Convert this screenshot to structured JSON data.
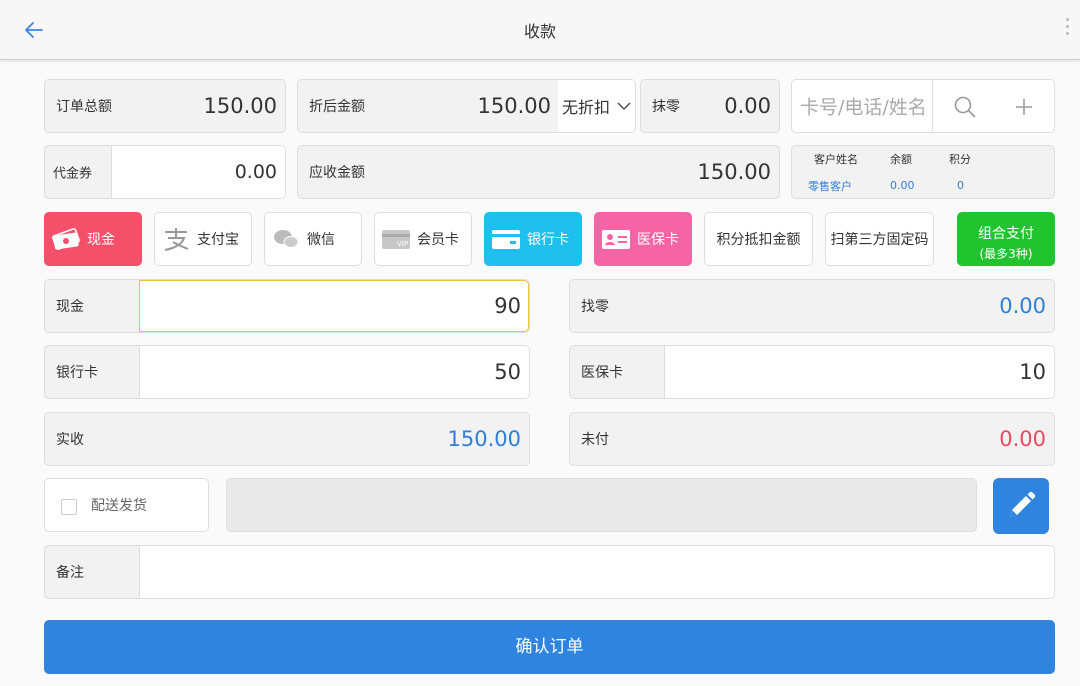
{
  "header": {
    "title": "收款"
  },
  "summary": {
    "order_total_label": "订单总额",
    "order_total_value": "150.00",
    "discounted_label": "折后金额",
    "discounted_value": "150.00",
    "discount_option": "无折扣",
    "rounding_label": "抹零",
    "rounding_value": "0.00",
    "member_search_placeholder": "卡号/电话/姓名",
    "voucher_label": "代金券",
    "voucher_value": "0.00",
    "receivable_label": "应收金额",
    "receivable_value": "150.00"
  },
  "customer": {
    "name_label": "客户姓名",
    "balance_label": "余额",
    "points_label": "积分",
    "name_value": "零售客户",
    "balance_value": "0.00",
    "points_value": "0"
  },
  "payment_methods": [
    {
      "label": "现金"
    },
    {
      "label": "支付宝"
    },
    {
      "label": "微信"
    },
    {
      "label": "会员卡"
    },
    {
      "label": "银行卡"
    },
    {
      "label": "医保卡"
    },
    {
      "label": "积分抵扣金额"
    },
    {
      "label": "扫第三方固定码"
    },
    {
      "label": "组合支付",
      "sublabel": "(最多3种)"
    }
  ],
  "amounts": {
    "cash_label": "现金",
    "cash_value": "90",
    "change_label": "找零",
    "change_value": "0.00",
    "bankcard_label": "银行卡",
    "bankcard_value": "50",
    "medical_label": "医保卡",
    "medical_value": "10",
    "received_label": "实收",
    "received_value": "150.00",
    "unpaid_label": "未付",
    "unpaid_value": "0.00"
  },
  "delivery": {
    "label": "配送发货"
  },
  "remarks": {
    "label": "备注"
  },
  "confirm": {
    "label": "确认订单"
  },
  "colors": {
    "primary": "#2f84e0",
    "cash": "#f5506a",
    "bankcard": "#1fc0ee",
    "medical": "#f565a5",
    "combo": "#21c42f",
    "focus": "#f1c232",
    "unpaid": "#e84a5f"
  }
}
